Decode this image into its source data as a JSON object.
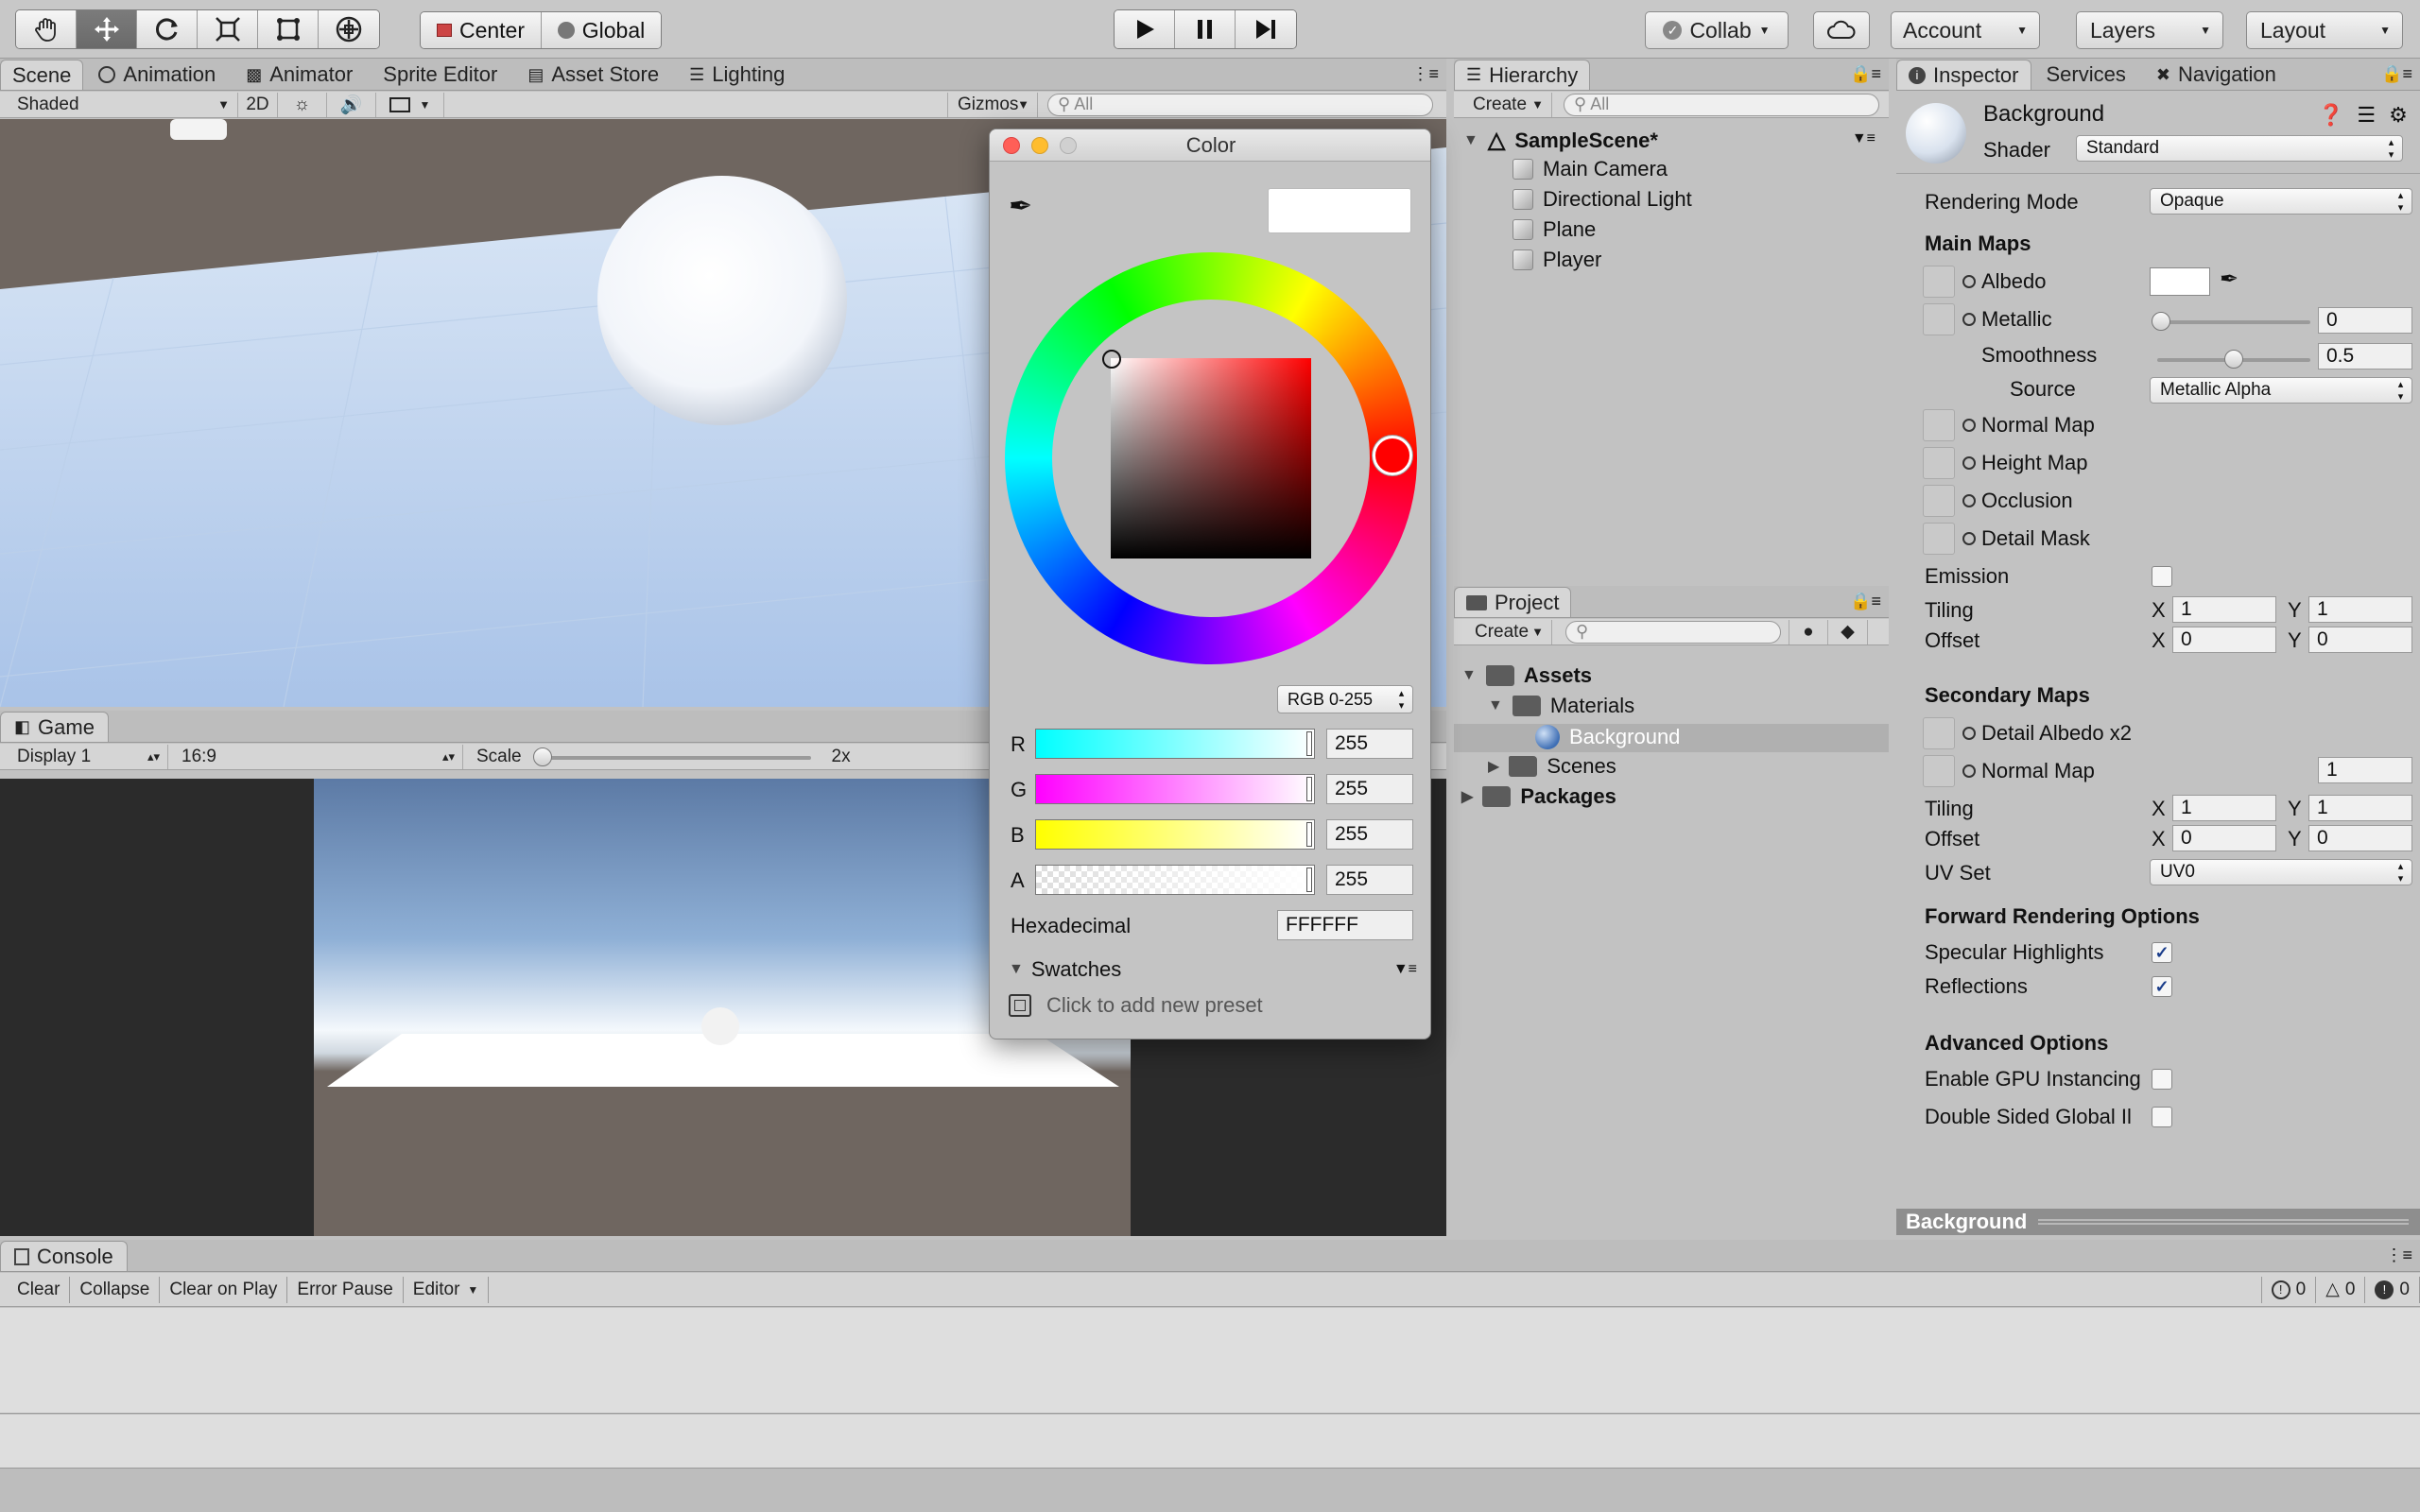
{
  "toolbar": {
    "tools": [
      "hand-icon",
      "move-icon",
      "rotate-icon",
      "scale-icon",
      "rect-icon",
      "transform-icon"
    ],
    "pivot": "Center",
    "space": "Global",
    "play": [
      "play-icon",
      "pause-icon",
      "step-icon"
    ],
    "collab": "Collab",
    "account": "Account",
    "layers": "Layers",
    "layout": "Layout"
  },
  "scene_tabs": [
    "Scene",
    "Animation",
    "Animator",
    "Sprite Editor",
    "Asset Store",
    "Lighting"
  ],
  "scene_bar": {
    "shading": "Shaded",
    "mode2d": "2D",
    "gizmos": "Gizmos",
    "search_placeholder": "All"
  },
  "game": {
    "tab": "Game",
    "display": "Display 1",
    "aspect": "16:9",
    "scale_label": "Scale",
    "scale_value": "2x"
  },
  "hierarchy": {
    "tab": "Hierarchy",
    "create": "Create",
    "search_placeholder": "All",
    "scene": "SampleScene*",
    "items": [
      "Main Camera",
      "Directional Light",
      "Plane",
      "Player"
    ]
  },
  "project": {
    "tab": "Project",
    "create": "Create",
    "assets": "Assets",
    "materials": "Materials",
    "selected": "Background",
    "scenes": "Scenes",
    "packages": "Packages"
  },
  "inspector": {
    "tabs": [
      "Inspector",
      "Services",
      "Navigation"
    ],
    "name": "Background",
    "shader_label": "Shader",
    "shader": "Standard",
    "rendering_mode_label": "Rendering Mode",
    "rendering_mode": "Opaque",
    "main_maps": "Main Maps",
    "albedo": "Albedo",
    "metallic": "Metallic",
    "metallic_value": "0",
    "smoothness": "Smoothness",
    "smoothness_value": "0.5",
    "source_label": "Source",
    "source": "Metallic Alpha",
    "normal_map": "Normal Map",
    "height_map": "Height Map",
    "occlusion": "Occlusion",
    "detail_mask": "Detail Mask",
    "emission": "Emission",
    "tiling": "Tiling",
    "offset": "Offset",
    "x": "X",
    "y": "Y",
    "tiling_x": "1",
    "tiling_y": "1",
    "offset_x": "0",
    "offset_y": "0",
    "secondary_maps": "Secondary Maps",
    "detail_albedo": "Detail Albedo x2",
    "normal_map2": "Normal Map",
    "normal_map2_value": "1",
    "tiling2_x": "1",
    "tiling2_y": "1",
    "offset2_x": "0",
    "offset2_y": "0",
    "uv_set_label": "UV Set",
    "uv_set": "UV0",
    "forward": "Forward Rendering Options",
    "specular": "Specular Highlights",
    "reflections": "Reflections",
    "advanced": "Advanced Options",
    "gpu_instancing": "Enable GPU Instancing",
    "double_sided": "Double Sided Global Il",
    "footer": "Background"
  },
  "color_picker": {
    "title": "Color",
    "mode": "RGB 0-255",
    "r_label": "R",
    "r": "255",
    "g_label": "G",
    "g": "255",
    "b_label": "B",
    "b": "255",
    "a_label": "A",
    "a": "255",
    "hex_label": "Hexadecimal",
    "hex": "FFFFFF",
    "swatches": "Swatches",
    "add_preset": "Click to add new preset"
  },
  "console": {
    "tab": "Console",
    "buttons": [
      "Clear",
      "Collapse",
      "Clear on Play",
      "Error Pause",
      "Editor"
    ],
    "counts": [
      "0",
      "0",
      "0"
    ]
  },
  "colors": {
    "accent": "#3f6fb5",
    "sky": "#c4d6ef",
    "ground": "#6f6660"
  }
}
